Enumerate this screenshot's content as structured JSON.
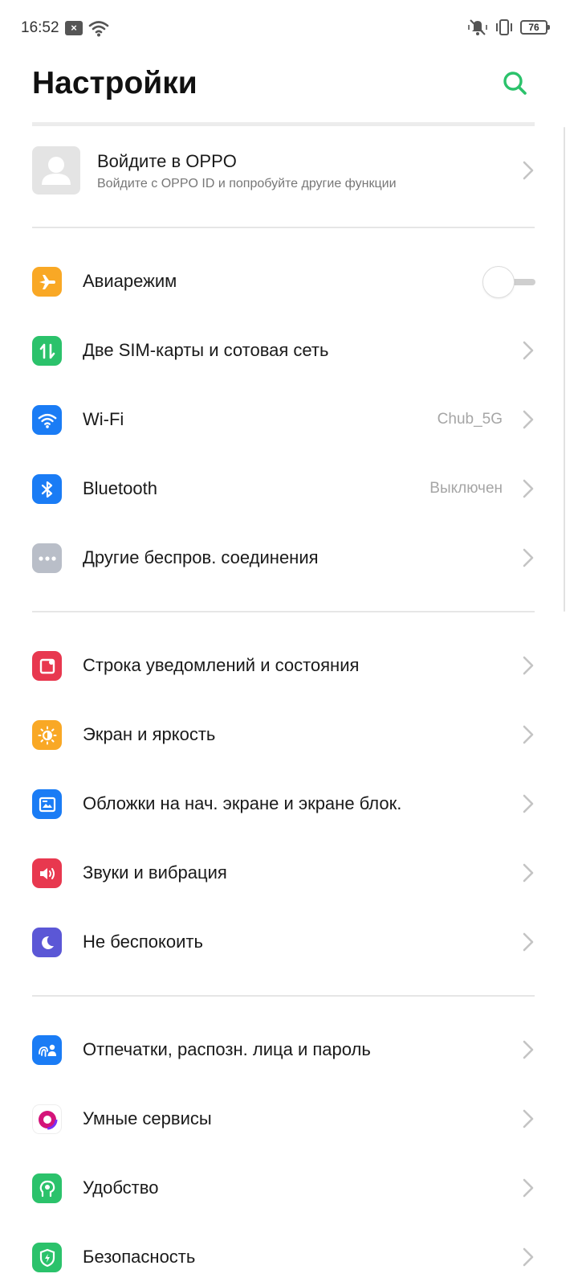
{
  "status_bar": {
    "time": "16:52",
    "notification_glyph": "×",
    "battery": "76"
  },
  "header": {
    "title": "Настройки"
  },
  "account": {
    "title": "Войдите в OPPO",
    "subtitle": "Войдите с OPPO ID и попробуйте другие функции"
  },
  "sections": {
    "connectivity": [
      {
        "label": "Авиарежим",
        "icon": "airplane-icon",
        "color": "#f9a825",
        "toggle": false
      },
      {
        "label": "Две SIM-карты и сотовая сеть",
        "icon": "sim-network-icon",
        "color": "#2bc26b"
      },
      {
        "label": "Wi-Fi",
        "icon": "wifi-icon",
        "color": "#1a7cf5",
        "value": "Chub_5G"
      },
      {
        "label": "Bluetooth",
        "icon": "bluetooth-icon",
        "color": "#1a7cf5",
        "value": "Выключен"
      },
      {
        "label": "Другие беспров. соединения",
        "icon": "more-connections-icon",
        "color": "#b9bec8"
      }
    ],
    "display": [
      {
        "label": "Строка уведомлений и состояния",
        "icon": "notification-bar-icon",
        "color": "#e8384f"
      },
      {
        "label": "Экран и яркость",
        "icon": "brightness-icon",
        "color": "#f9a825"
      },
      {
        "label": "Обложки на нач. экране и экране блок.",
        "icon": "wallpaper-icon",
        "color": "#1a7cf5"
      },
      {
        "label": "Звуки и вибрация",
        "icon": "sound-icon",
        "color": "#e8384f"
      },
      {
        "label": "Не беспокоить",
        "icon": "moon-icon",
        "color": "#5b57d6"
      }
    ],
    "security": [
      {
        "label": "Отпечатки, распозн. лица и пароль",
        "icon": "fingerprint-face-icon",
        "color": "#1a7cf5"
      },
      {
        "label": "Умные сервисы",
        "icon": "smart-services-icon",
        "color": "#d4147a"
      },
      {
        "label": "Удобство",
        "icon": "convenience-icon",
        "color": "#2bc26b"
      },
      {
        "label": "Безопасность",
        "icon": "security-icon",
        "color": "#2bc26b"
      }
    ]
  }
}
